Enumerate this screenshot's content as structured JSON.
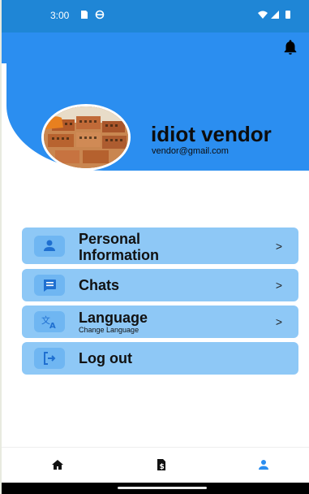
{
  "status": {
    "time": "3:00"
  },
  "profile": {
    "name": "idiot vendor",
    "email": "vendor@gmail.com"
  },
  "menu": [
    {
      "label": "Personal\nInformation",
      "sub": "",
      "chevron": ">"
    },
    {
      "label": "Chats",
      "sub": "",
      "chevron": ">"
    },
    {
      "label": "Language",
      "sub": "Change Language",
      "chevron": ">"
    },
    {
      "label": "Log out",
      "sub": "",
      "chevron": ""
    }
  ],
  "icons": {
    "menu": [
      "person-icon",
      "chat-icon",
      "translate-icon",
      "logout-icon"
    ],
    "nav": [
      "home-icon",
      "vendor-icon",
      "profile-icon"
    ]
  },
  "colors": {
    "primary": "#2b8ef0",
    "status": "#1f86d6",
    "card": "#8ec8f6",
    "icon_box": "#6fb6f2"
  }
}
